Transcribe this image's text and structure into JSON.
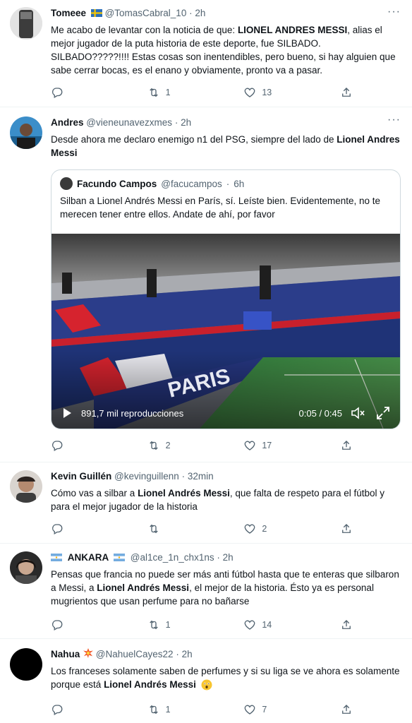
{
  "tweets": [
    {
      "name": "Tomeee",
      "handle": "@TomasCabral_10",
      "dot": "·",
      "time": "2h",
      "text_a": "Me acabo de levantar con la noticia de que: ",
      "text_b": "LIONEL ANDRES MESSI",
      "text_c": ", alias el mejor jugador de la puta historia de este deporte, fue SILBADO. SILBADO?????!!!! Estas cosas son inentendibles, pero bueno, si hay alguien que sabe cerrar bocas, es el enano y obviamente, pronto va a pasar.",
      "reply_count": "",
      "retweet_count": "1",
      "like_count": "13"
    },
    {
      "name": "Andres",
      "handle": "@vieneunavezxmes",
      "dot": "·",
      "time": "2h",
      "text_a": "Desde ahora me declaro enemigo n1 del PSG, siempre del lado de ",
      "text_b": "Lionel Andres Messi",
      "text_c": "",
      "reply_count": "",
      "retweet_count": "2",
      "like_count": "17",
      "quote": {
        "name": "Facundo Campos",
        "handle": "@facucampos",
        "dot": "·",
        "time": "6h",
        "text": "Silban a Lionel Andrés Messi en París, sí. Leíste bien. Evidentemente, no te merecen tener entre ellos. Andate de ahí, por favor",
        "video": {
          "views": "891,7 mil reproducciones",
          "time": "0:05 / 0:45",
          "banner_text": "PARIS"
        }
      }
    },
    {
      "name": "Kevin Guillén",
      "handle": "@kevinguillenn",
      "dot": "·",
      "time": "32min",
      "text_a": "Cómo vas a silbar a ",
      "text_b": "Lionel Andrés Messi",
      "text_c": ", que falta de respeto para el fútbol y para el mejor jugador de la historia",
      "reply_count": "",
      "retweet_count": "",
      "like_count": "2"
    },
    {
      "name": "ANKARA",
      "handle": "@al1ce_1n_chx1ns",
      "dot": "·",
      "time": "2h",
      "text_a": "Pensas que francia no puede ser más anti fútbol hasta que te enteras que silbaron a Messi, a ",
      "text_b": "Lionel Andrés Messi",
      "text_c": ", el mejor de la historia. Ésto ya es personal mugrientos que usan perfume para no bañarse",
      "reply_count": "",
      "retweet_count": "1",
      "like_count": "14"
    },
    {
      "name": "Nahua",
      "handle": "@NahuelCayes22",
      "dot": "·",
      "time": "2h",
      "text_a": "Los franceses solamente saben de perfumes y si su liga se ve ahora es solamente porque está ",
      "text_b": "Lionel Andrés Messi",
      "text_c": "",
      "reply_count": "",
      "retweet_count": "1",
      "like_count": "7"
    }
  ],
  "icons": {
    "reply": "reply-icon",
    "retweet": "retweet-icon",
    "like": "heart-icon",
    "share": "share-icon",
    "more": "more-icon"
  },
  "colors": {
    "text": "#0f1419",
    "secondary": "#536471",
    "border": "#eff3f4"
  }
}
